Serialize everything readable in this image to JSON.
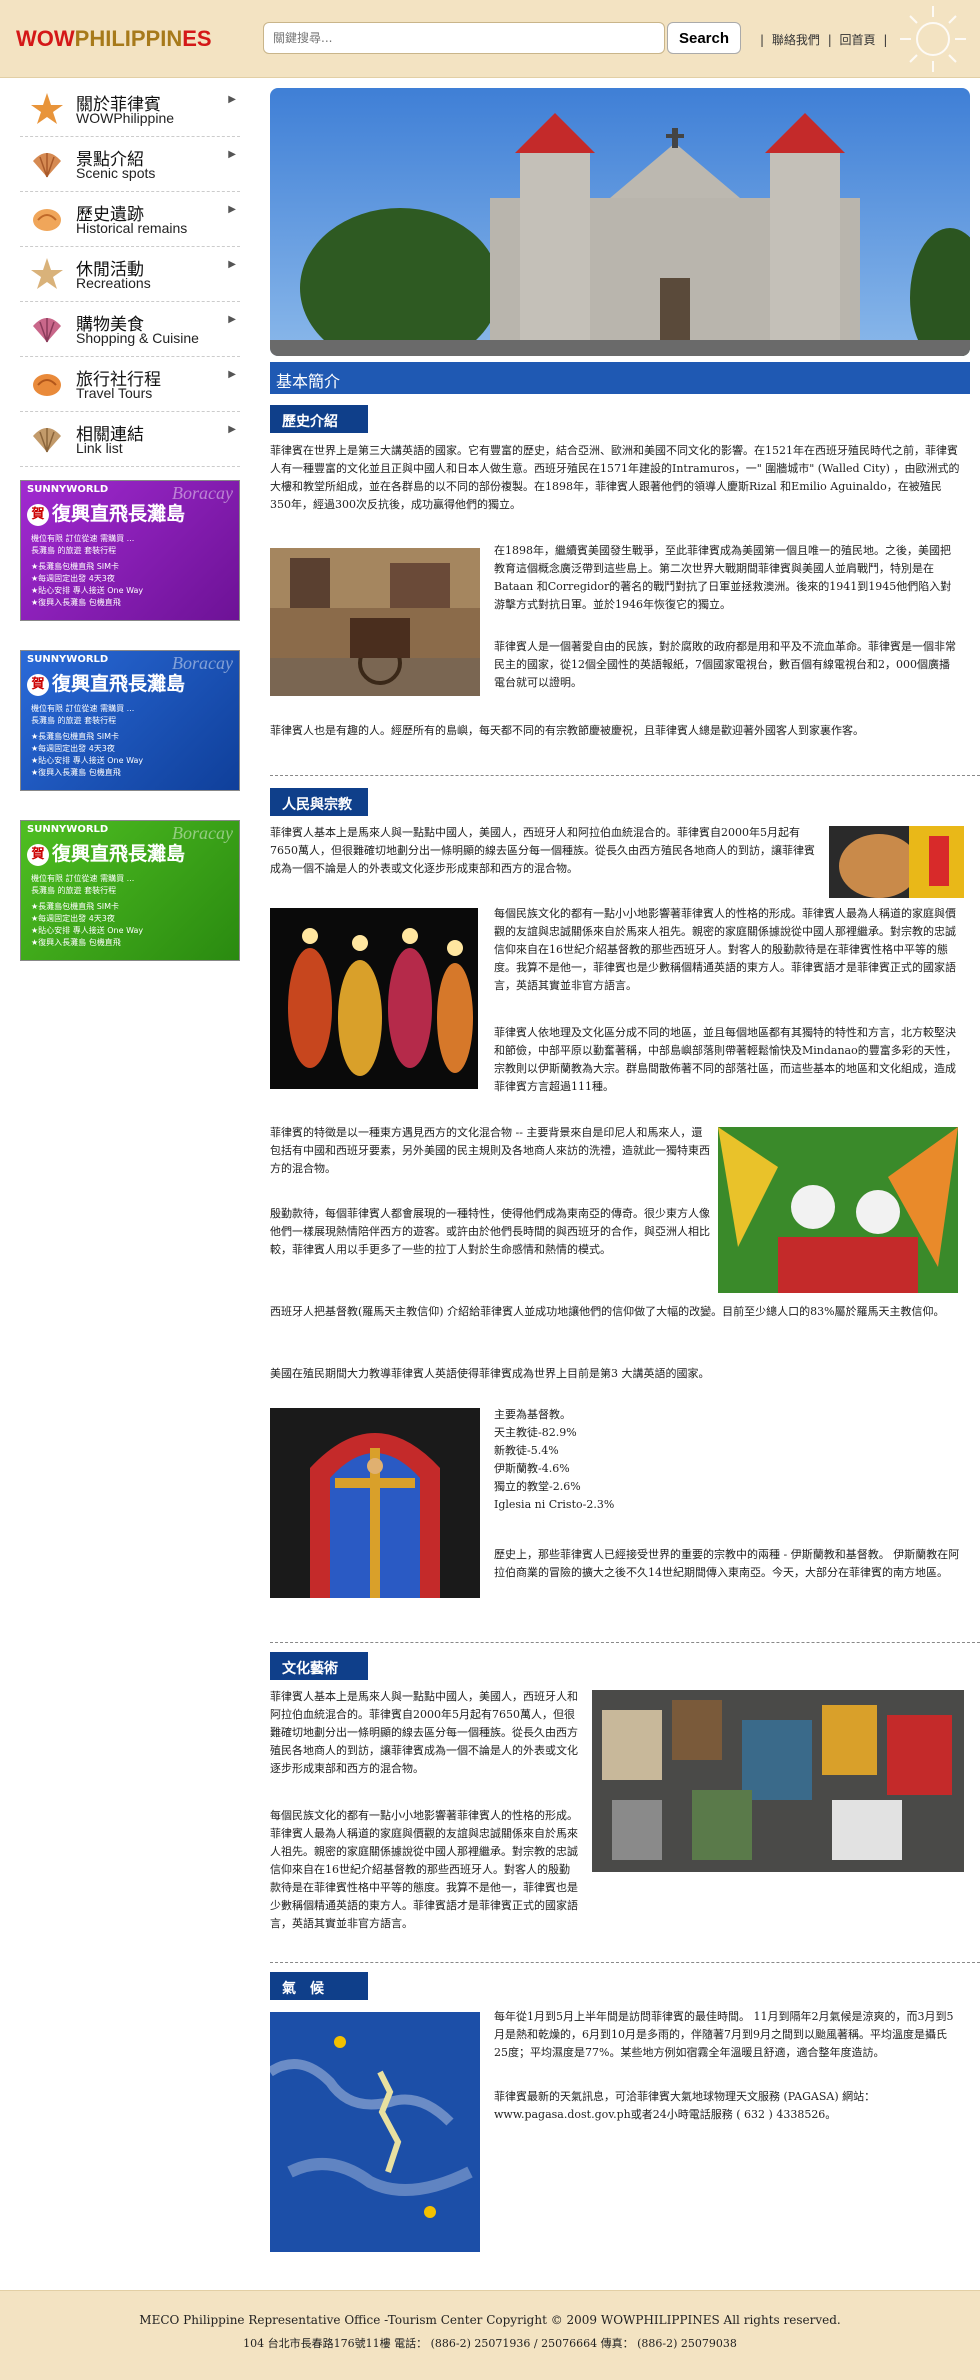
{
  "header": {
    "logo_wow": "WOW",
    "logo_ph": "PHILIPPIN",
    "logo_es": "ES",
    "search_placeholder": "關鍵搜尋...",
    "search_button": "Search",
    "links": [
      "聯絡我們",
      "回首頁"
    ]
  },
  "sidebar": {
    "items": [
      {
        "zh": "關於菲律賓",
        "en": "WOWPhilippine",
        "icon": "starfish-icon"
      },
      {
        "zh": "景點介紹",
        "en": "Scenic spots",
        "icon": "scallop-shell-icon"
      },
      {
        "zh": "歷史遺跡",
        "en": "Historical remains",
        "icon": "conch-shell-icon"
      },
      {
        "zh": "休閒活動",
        "en": "Recreations",
        "icon": "starfish-icon"
      },
      {
        "zh": "購物美食",
        "en": "Shopping & Cuisine",
        "icon": "scallop-shell-icon"
      },
      {
        "zh": "旅行社行程",
        "en": "Travel Tours",
        "icon": "conch-shell-icon"
      },
      {
        "zh": "相關連結",
        "en": "Link list",
        "icon": "scallop-shell-icon"
      }
    ]
  },
  "ads": [
    {
      "top": "SUNNYWORLD",
      "script": "Boracay",
      "badge": "賀",
      "title": "復興直飛長灘島",
      "color": "#8a1fb3",
      "lines": [
        "機位有限 訂位從速 需購買 ...",
        "長灘島 的旅遊 套裝行程",
        "★長灘島包機直飛 SIM卡",
        "★每週固定出發 4天3夜",
        "★貼心安排 專人接送 One Way",
        "★復興入長灘島 包機直飛"
      ]
    },
    {
      "top": "SUNNYWORLD",
      "script": "Boracay",
      "badge": "賀",
      "title": "復興直飛長灘島",
      "color": "#1a57b5",
      "lines": [
        "機位有限 訂位從速 需購買 ...",
        "長灘島 的旅遊 套裝行程",
        "★長灘島包機直飛 SIM卡",
        "★每週固定出發 4天3夜",
        "★貼心安排 專人接送 One Way",
        "★復興入長灘島 包機直飛"
      ]
    },
    {
      "top": "SUNNYWORLD",
      "script": "Boracay",
      "badge": "賀",
      "title": "復興直飛長灘島",
      "color": "#3ca018",
      "lines": [
        "機位有限 訂位從速 需購買 ...",
        "長灘島 的旅遊 套裝行程",
        "★長灘島包機直飛 SIM卡",
        "★每週固定出發 4天3夜",
        "★貼心安排 專人接送 One Way",
        "★復興入長灘島 包機直飛"
      ]
    }
  ],
  "main": {
    "title": "基本簡介",
    "sections": {
      "history": {
        "heading": "歷史介紹",
        "p1": "菲律賓在世界上是第三大講英語的國家。它有豐富的歷史，結合亞洲、歐洲和美國不同文化的影響。在1521年在西班牙殖民時代之前，菲律賓人有一種豐富的文化並且正與中國人和日本人做生意。西班牙殖民在1571年建設的Intramuros，一\" 圍牆城市\" (Walled City) ，由歐洲式的大樓和教堂所組成，並在各群島的以不同的部份複製。在1898年，菲律賓人跟著他們的領導人慶斯Rizal 和Emilio Aguinaldo，在被殖民350年，經過300次反抗後，成功贏得他們的獨立。",
        "p2": "在1898年，繼續賓美國發生戰爭，至此菲律賓成為美國第一個且唯一的殖民地。之後，美國把教育這個概念廣泛帶到這些島上。第二次世界大戰期間菲律賓與美國人並肩戰鬥，特別是在Bataan 和Corregidor的著名的戰鬥對抗了日軍並拯救澳洲。後來的1941到1945他們陷入對游擊方式對抗日軍。並於1946年恢復它的獨立。",
        "p3": "菲律賓人是一個著愛自由的民族，對於腐敗的政府都是用和平及不流血革命。菲律賓是一個非常民主的國家，從12個全國性的英語報紙，7個國家電視台，數百個有線電視台和2，000個廣播電台就可以證明。",
        "p4": "菲律賓人也是有趣的人。經歷所有的島嶼，每天都不同的有宗教節慶被慶祝，且菲律賓人總是歡迎著外國客人到家裏作客。"
      },
      "people": {
        "heading": "人民與宗教",
        "p1": "菲律賓人基本上是馬來人與一點點中國人，美國人，西班牙人和阿拉伯血統混合的。菲律賓自2000年5月起有7650萬人，但很難確切地劃分出一條明顯的線去區分每一個種族。從長久由西方殖民各地商人的到訪，讓菲律賓成為一個不論是人的外表或文化逐步形成東部和西方的混合物。",
        "p2": "每個民族文化的都有一點小小地影響著菲律賓人的性格的形成。菲律賓人最為人稱道的家庭與價觀的友誼與忠誠關係來自於馬來人祖先。親密的家庭關係據說從中國人那裡繼承。對宗教的忠誠信仰來自在16世紀介紹基督教的那些西班牙人。對客人的殷勤款待是在菲律賓性格中平等的態度。我算不是他一，菲律賓也是少數稱個精通英語的東方人。菲律賓語才是菲律賓正式的國家語言，英語其實並非官方語言。",
        "p3": "菲律賓人依地理及文化區分成不同的地區，並且每個地區都有其獨特的特性和方言，北方較堅決和節儉，中部平原以勤奮著稱，中部島嶼部落則帶著輕鬆愉快及Mindanao的豐富多彩的天性，宗教則以伊斯蘭教為大宗。群島間散佈著不同的部落社區，而這些基本的地區和文化組成，造成菲律賓方言超過111種。",
        "p4": "菲律賓的特徵是以一種東方遇見西方的文化混合物 -- 主要背景來自是印尼人和馬來人，還包括有中國和西班牙要素，另外美國的民主規則及各地商人來訪的洗禮，造就此一獨特東西方的混合物。",
        "p5": "殷勤款待，每個菲律賓人都會展現的一種特性，使得他們成為東南亞的傳奇。很少東方人像他們一樣展現熱情陪伴西方的遊客。或許由於他們長時間的與西班牙的合作，與亞洲人相比較，菲律賓人用以手更多了一些的拉丁人對於生命感情和熱情的模式。",
        "p6": "西班牙人把基督教(羅馬天主教信仰) 介紹給菲律賓人並成功地讓他們的信仰做了大幅的改變。目前至少總人口的83%屬於羅馬天主教信仰。",
        "p7": "美國在殖民期間大力教導菲律賓人英語使得菲律賓成為世界上目前是第3 大講英語的國家。",
        "religions": [
          "主要為基督教。",
          "天主教徒-82.9%",
          "新教徒-5.4%",
          "伊斯蘭教-4.6%",
          "獨立的教堂-2.6%",
          "Iglesia ni Cristo-2.3%"
        ],
        "p8": "歷史上，那些菲律賓人已經接受世界的重要的宗教中的兩種 - 伊斯蘭教和基督教。 伊斯蘭教在阿拉伯商業的冒險的擴大之後不久14世紀期間傳入東南亞。今天，大部分在菲律賓的南方地區。"
      },
      "culture": {
        "heading": "文化藝術",
        "p1": "菲律賓人基本上是馬來人與一點點中國人，美國人，西班牙人和阿拉伯血統混合的。菲律賓自2000年5月起有7650萬人，但很難確切地劃分出一條明顯的線去區分每一個種族。從長久由西方殖民各地商人的到訪，讓菲律賓成為一個不論是人的外表或文化逐步形成東部和西方的混合物。",
        "p2": "每個民族文化的都有一點小小地影響著菲律賓人的性格的形成。菲律賓人最為人稱道的家庭與價觀的友誼與忠誠關係來自於馬來人祖先。親密的家庭關係據說從中國人那裡繼承。對宗教的忠誠信仰來自在16世紀介紹基督教的那些西班牙人。對客人的殷勤款待是在菲律賓性格中平等的態度。我算不是他一，菲律賓也是少數稱個精通英語的東方人。菲律賓語才是菲律賓正式的國家語言，英語其實並非官方語言。"
      },
      "climate": {
        "heading": "氣　候",
        "p1": "每年從1月到5月上半年間是訪問菲律賓的最佳時間。 11月到隔年2月氣候是涼爽的，而3月到5月是熱和乾燥的，6月到10月是多雨的，伴隨著7月到9月之間到以颱風著稱。平均溫度是攝氏25度；平均濕度是77%。某些地方例如宿霧全年溫暖且舒適，適合整年度造訪。",
        "p2": "菲律賓最新的天氣訊息，可洽菲律賓大氣地球物理天文服務 (PAGASA) 網站：",
        "p3": "www.pagasa.dost.gov.ph或者24小時電話服務 ( 632 ) 4338526。"
      }
    }
  },
  "footer": {
    "line1": "MECO Philippine Representative Office -Tourism Center     Copyright © 2009 WOWPHILIPPINES All rights reserved.",
    "line2": "104 台北市長春路176號11樓        電話： (886-2) 25071936 / 25076664        傳真： (886-2) 25079038"
  }
}
